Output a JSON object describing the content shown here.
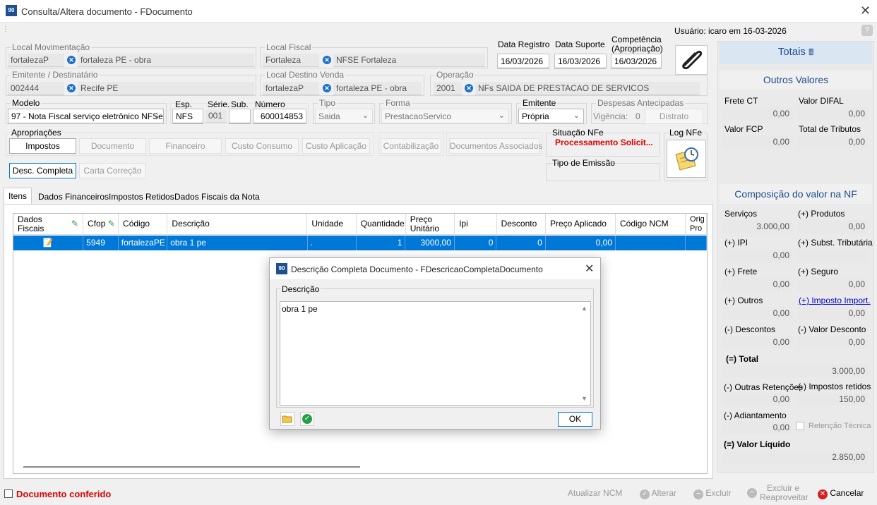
{
  "window": {
    "title": "Consulta/Altera documento - FDocumento",
    "app_icon": "90",
    "user_info": "Usuário: icaro em 16-03-2026"
  },
  "header": {
    "local_mov": {
      "label": "Local Movimentação",
      "code": "fortalezaP",
      "desc": "fortaleza PE - obra"
    },
    "local_fiscal": {
      "label": "Local Fiscal",
      "code": "Fortaleza",
      "desc": "NFSE Fortaleza"
    },
    "data_registro": {
      "label": "Data Registro",
      "value": "16/03/2026"
    },
    "data_suporte": {
      "label": "Data Suporte",
      "value": "16/03/2026"
    },
    "competencia": {
      "label": "Competência (Apropriação)",
      "value": "16/03/2026"
    },
    "emitente": {
      "label": "Emitente / Destinatário",
      "code": "002444",
      "desc": "Recife PE"
    },
    "local_destino": {
      "label": "Local Destino Venda",
      "code": "fortalezaP",
      "desc": "fortaleza PE - obra"
    },
    "operacao": {
      "label": "Operação",
      "code": "2001",
      "desc": "NFs SAIDA DE PRESTACAO DE SERVICOS"
    },
    "modelo": {
      "label": "Modelo",
      "value": "97 - Nota Fiscal serviço eletrônico NFSe"
    },
    "esp": {
      "label": "Esp.",
      "value": "NFS"
    },
    "serie": {
      "label": "Série.",
      "value": "001"
    },
    "sub": {
      "label": "Sub.",
      "value": ""
    },
    "numero": {
      "label": "Número",
      "value": "600014853"
    },
    "tipo": {
      "label": "Tipo",
      "value": "Saida"
    },
    "forma": {
      "label": "Forma",
      "value": "PrestacaoServico"
    },
    "emitente_sel": {
      "label": "Emitente",
      "value": "Própria"
    },
    "despesas": {
      "label": "Despesas Antecipadas",
      "vigencia_label": "Vigência:",
      "vigencia_value": "0",
      "distrato": "Distrato"
    }
  },
  "apropriacoes": {
    "label": "Apropriações",
    "buttons": [
      "Impostos",
      "Documento",
      "Financeiro",
      "Custo Consumo",
      "Custo Aplicação"
    ],
    "contab": "Contabilização",
    "docs_assoc": "Documentos Associados"
  },
  "situacao": {
    "label": "Situação NFe",
    "value": "Processamento Solicit...",
    "tipo_emissao_label": "Tipo de Emissão",
    "log_label": "Log NFe"
  },
  "desc_buttons": {
    "desc_completa": "Desc. Completa",
    "carta_correcao": "Carta Correção"
  },
  "tabs": [
    "Itens",
    "Dados Financeiros",
    "Impostos Retidos",
    "Dados Fiscais da Nota"
  ],
  "grid": {
    "headers": [
      "Dados Fiscais",
      "Cfop",
      "Código",
      "Descrição",
      "Unidade",
      "Quantidade",
      "Preço Unitário",
      "Ipi",
      "Desconto",
      "Preço Aplicado",
      "Código NCM",
      "Orig Pro"
    ],
    "rows": [
      {
        "cfop": "5949",
        "codigo": "fortalezaPE",
        "descricao": "obra 1 pe",
        "unidade": ".",
        "quantidade": "1",
        "preco_unit": "3000,00",
        "ipi": "0",
        "desconto": "0",
        "preco_aplicado": "0,00",
        "ncm": ""
      }
    ]
  },
  "dialog": {
    "title": "Descrição Completa Documento - FDescricaoCompletaDocumento",
    "group_label": "Descrição",
    "text": "obra 1 pe",
    "ok": "OK"
  },
  "totais": {
    "title": "Totais",
    "outros_valores": "Outros Valores",
    "frete_ct": {
      "label": "Frete CT",
      "value": "0,00"
    },
    "valor_difal": {
      "label": "Valor DIFAL",
      "value": "0,00"
    },
    "valor_fcp": {
      "label": "Valor FCP",
      "value": "0,00"
    },
    "total_tributos": {
      "label": "Total de Tributos",
      "value": "0,00"
    },
    "composicao": "Composição do valor na NF",
    "servicos": {
      "label": "Serviços",
      "value": "3.000,00"
    },
    "produtos": {
      "label": "(+) Produtos",
      "value": "0,00"
    },
    "ipi": {
      "label": "(+) IPI",
      "value": "0,00"
    },
    "subst": {
      "label": "(+) Subst. Tributária",
      "value": ""
    },
    "frete": {
      "label": "(+) Frete",
      "value": "0,00"
    },
    "seguro": {
      "label": "(+) Seguro",
      "value": "0,00"
    },
    "outros": {
      "label": "(+) Outros",
      "value": "0,00"
    },
    "imposto_import": {
      "label": "(+) Imposto Import.",
      "value": "0,00"
    },
    "descontos": {
      "label": "(-) Descontos",
      "value": "0,00"
    },
    "valor_desconto": {
      "label": "(-) Valor Desconto",
      "value": "0,00"
    },
    "total": {
      "label": "(=) Total",
      "value": "3.000,00"
    },
    "outras_ret": {
      "label": "(-) Outras Retenções",
      "value": "0,00"
    },
    "impostos_ret": {
      "label": "(-) Impostos retidos",
      "value": "150,00"
    },
    "adiantamento": {
      "label": "(-) Adiantamento",
      "value": "0,00"
    },
    "retencao_tecnica": "Retenção Técnica",
    "valor_liquido": {
      "label": "(=) Valor Líquido",
      "value": "2.850,00"
    }
  },
  "footer": {
    "conferido": "Documento conferido",
    "atualizar_ncm": "Atualizar NCM",
    "alterar": "Alterar",
    "excluir": "Excluir",
    "excluir_reaproveitar": "Excluir e Reaproveitar",
    "cancelar": "Cancelar"
  },
  "colors": {
    "accent": "#0078d7",
    "red": "#e00000",
    "totais_bg": "#dbe6f3",
    "totais_text": "#1f4e8c"
  }
}
